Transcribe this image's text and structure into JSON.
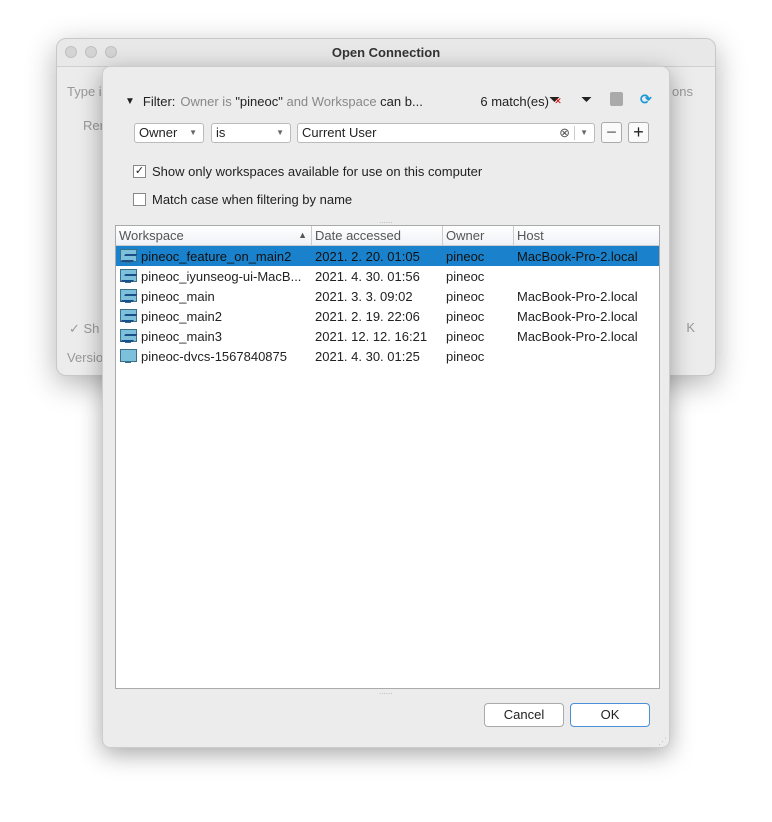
{
  "background_window": {
    "title": "Open Connection",
    "type_label_partial": "Type i",
    "tab_partial": "Ren",
    "options_partial": "ons",
    "show_partial": "Sh",
    "version_partial": "Versio",
    "ok_partial": "K"
  },
  "filter": {
    "label": "Filter:",
    "summary_part1": "Owner is ",
    "summary_value": "\"pineoc\"",
    "summary_part2": " and Workspace ",
    "summary_part3": "can b...",
    "matches": "6 match(es)",
    "field": "Owner",
    "operator": "is",
    "value": "Current User"
  },
  "options": {
    "show_available": {
      "label": "Show only workspaces available for use on this computer",
      "checked": true
    },
    "match_case": {
      "label": "Match case when filtering by name",
      "checked": false
    }
  },
  "table": {
    "columns": [
      "Workspace",
      "Date accessed",
      "Owner",
      "Host"
    ],
    "sort": "Workspace ascending",
    "rows": [
      {
        "workspace": "pineoc_feature_on_main2",
        "date": "2021. 2. 20. 01:05",
        "owner": "pineoc",
        "host": "MacBook-Pro-2.local",
        "selected": true,
        "icon": "workspace-sync-icon"
      },
      {
        "workspace": "pineoc_iyunseog-ui-MacB...",
        "date": "2021. 4. 30. 01:56",
        "owner": "pineoc",
        "host": "",
        "icon": "workspace-sync-icon"
      },
      {
        "workspace": "pineoc_main",
        "date": "2021. 3. 3. 09:02",
        "owner": "pineoc",
        "host": "MacBook-Pro-2.local",
        "icon": "workspace-sync-icon"
      },
      {
        "workspace": "pineoc_main2",
        "date": "2021. 2. 19. 22:06",
        "owner": "pineoc",
        "host": "MacBook-Pro-2.local",
        "icon": "workspace-sync-icon"
      },
      {
        "workspace": "pineoc_main3",
        "date": "2021. 12. 12. 16:21",
        "owner": "pineoc",
        "host": "MacBook-Pro-2.local",
        "icon": "workspace-sync-icon"
      },
      {
        "workspace": "pineoc-dvcs-1567840875",
        "date": "2021. 4. 30. 01:25",
        "owner": "pineoc",
        "host": "",
        "icon": "workspace-icon"
      }
    ]
  },
  "buttons": {
    "cancel": "Cancel",
    "ok": "OK"
  },
  "colors": {
    "selection": "#1a82cc",
    "refresh": "#1a9ad6",
    "clear_filter_x": "#d00000"
  }
}
